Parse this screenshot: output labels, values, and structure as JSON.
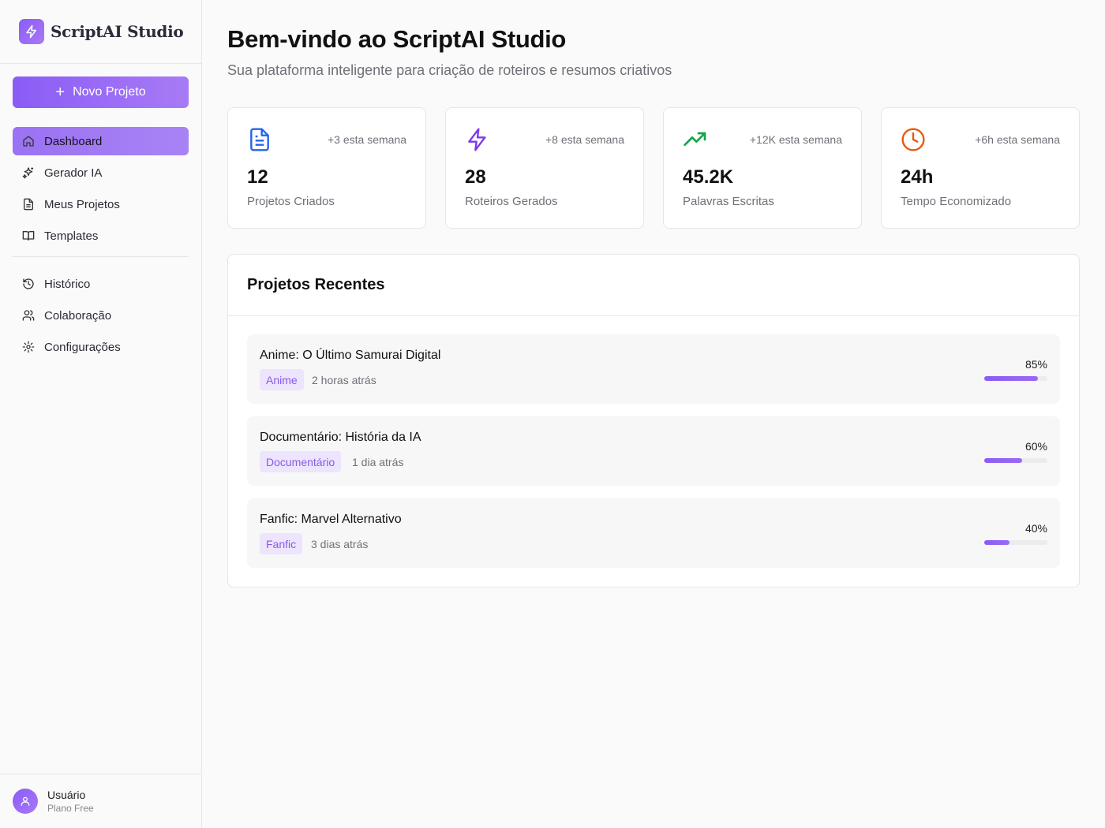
{
  "brand": {
    "name": "ScriptAI Studio"
  },
  "sidebar": {
    "new_project_label": "Novo Projeto",
    "items": [
      {
        "label": "Dashboard",
        "icon": "home-icon",
        "active": true
      },
      {
        "label": "Gerador IA",
        "icon": "sparkles-icon"
      },
      {
        "label": "Meus Projetos",
        "icon": "file-icon"
      },
      {
        "label": "Templates",
        "icon": "book-icon"
      },
      {
        "label": "Histórico",
        "icon": "history-icon"
      },
      {
        "label": "Colaboração",
        "icon": "users-icon"
      },
      {
        "label": "Configurações",
        "icon": "gear-icon"
      }
    ],
    "user": {
      "name": "Usuário",
      "plan": "Plano Free"
    }
  },
  "header": {
    "title": "Bem-vindo ao ScriptAI Studio",
    "subtitle": "Sua plataforma inteligente para criação de roteiros e resumos criativos"
  },
  "stats": [
    {
      "value": "12",
      "label": "Projetos Criados",
      "delta": "+3 esta semana",
      "icon": "document-icon",
      "color": "#2563eb"
    },
    {
      "value": "28",
      "label": "Roteiros Gerados",
      "delta": "+8 esta semana",
      "icon": "lightning-icon",
      "color": "#7c3aed"
    },
    {
      "value": "45.2K",
      "label": "Palavras Escritas",
      "delta": "+12K esta semana",
      "icon": "trending-up-icon",
      "color": "#16a34a"
    },
    {
      "value": "24h",
      "label": "Tempo Economizado",
      "delta": "+6h esta semana",
      "icon": "clock-icon",
      "color": "#ea580c"
    }
  ],
  "recent": {
    "title": "Projetos Recentes",
    "projects": [
      {
        "title": "Anime: O Último Samurai Digital",
        "tag": "Anime",
        "time": "2 horas atrás",
        "progress": 85,
        "progress_label": "85%"
      },
      {
        "title": "Documentário: História da IA",
        "tag": "Documentário",
        "time": "1 dia atrás",
        "progress": 60,
        "progress_label": "60%"
      },
      {
        "title": "Fanfic: Marvel Alternativo",
        "tag": "Fanfic",
        "time": "3 dias atrás",
        "progress": 40,
        "progress_label": "40%"
      }
    ]
  }
}
